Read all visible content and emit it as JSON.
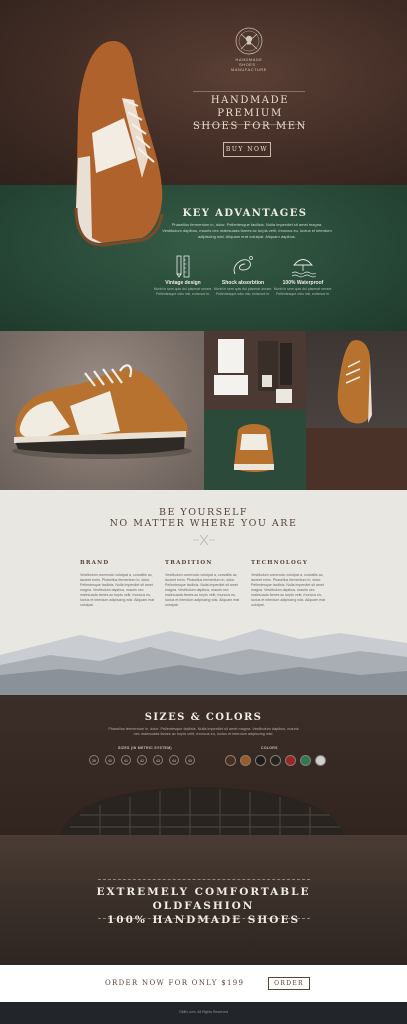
{
  "hero": {
    "emblem_text": "HANDMADE SHOES · MANUFACTURE",
    "title_line1": "HANDMADE PREMIUM",
    "title_line2": "SHOES FOR MEN",
    "buy_label": "BUY NOW"
  },
  "advantages": {
    "title": "KEY ADVANTAGES",
    "subtitle": "Phasellus fermentum in, dolor. Pellentesque facilisis. Nulla imperdiet sit amet magna. Vestibulum dapibus, mauris nec malesuada fames ac turpis velit, rhoncus eu, luctus et interdum adipiscing wisi. Aliquam erat volutpat. Aliquam dapibus.",
    "features": [
      {
        "icon": "pencil-ruler-icon",
        "label": "Vintage design",
        "desc": "Morbi in sem quis dui placerat ornare. Pellentesque odio nisi, euismod in."
      },
      {
        "icon": "lace-icon",
        "label": "Shock absorbtion",
        "desc": "Morbi in sem quis dui placerat ornare. Pellentesque odio nisi, euismod in."
      },
      {
        "icon": "umbrella-icon",
        "label": "100% Waterproof",
        "desc": "Morbi in sem quis dui placerat ornare. Pellentesque odio nisi, euismod in."
      }
    ]
  },
  "be_yourself": {
    "title_line1": "BE YOURSELF",
    "title_line2": "NO MATTER WHERE YOU ARE",
    "columns": [
      {
        "heading": "BRAND",
        "text": "Vestibulum commodo volutpat a, convallis ac, laoreet enim. Phasellus fermentum in, dolor. Pellentesque facilisis. Nulla imperdiet sit amet magna. Vestibulum dapibus, mauris nec malesuada fames ac turpis velit, rhoncus eu, luctus et interdum adipiscing wisi. Aliquam erat volutpat."
      },
      {
        "heading": "TRADITION",
        "text": "Vestibulum commodo volutpat a, convallis ac, laoreet enim. Phasellus fermentum in, dolor. Pellentesque facilisis. Nulla imperdiet sit amet magna. Vestibulum dapibus, mauris nec malesuada fames ac turpis velit, rhoncus eu, luctus et interdum adipiscing wisi. Aliquam erat volutpat."
      },
      {
        "heading": "TECHNOLOGY",
        "text": "Vestibulum commodo volutpat a, convallis ac, laoreet enim. Phasellus fermentum in, dolor. Pellentesque facilisis. Nulla imperdiet sit amet magna. Vestibulum dapibus, mauris nec malesuada fames ac turpis velit, rhoncus eu, luctus et interdum adipiscing wisi. Aliquam erat volutpat."
      }
    ]
  },
  "sizes": {
    "title": "SIZES & COLORS",
    "subtitle": "Phasellus fermentum in, dolor. Pellentesque facilisis. Nulla imperdiet sit amet magna. Vestibulum dapibus, mauris nec malesuada fames ac turpis velit, rhoncus eu, luctus et interdum adipiscing wisi.",
    "sizes_label": "SIZES (IN METRIC SYSTEM)",
    "size_values": [
      "39",
      "40",
      "41",
      "42",
      "43",
      "44",
      "45"
    ],
    "colors_label": "COLORS",
    "color_values": [
      "#4a2e22",
      "#9a5a2a",
      "#1b1b1b",
      "#232323",
      "#9b2626",
      "#2f7a55",
      "#cfcfcf"
    ]
  },
  "comfort": {
    "line1": "EXTREMELY COMFORTABLE OLDFASHION",
    "line2": "100% HANDMADE SHOES"
  },
  "order": {
    "text": "ORDER NOW FOR ONLY $199",
    "button": "ORDER"
  },
  "footer": {
    "text": "Oldfix.com. All Rights Reserved"
  }
}
